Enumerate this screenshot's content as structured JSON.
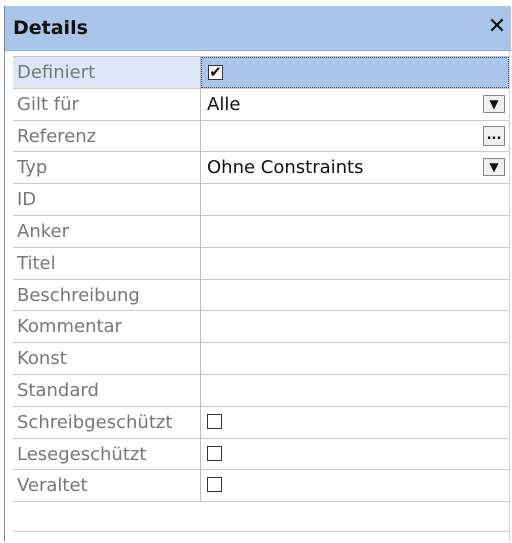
{
  "panel": {
    "title": "Details",
    "close_glyph": "✕"
  },
  "rows": [
    {
      "label": "Definiert",
      "type": "checkbox",
      "checked": true
    },
    {
      "label": "Gilt für",
      "type": "dropdown",
      "value": "Alle"
    },
    {
      "label": "Referenz",
      "type": "ellipsis",
      "value": ""
    },
    {
      "label": "Typ",
      "type": "dropdown",
      "value": "Ohne Constraints"
    },
    {
      "label": "ID",
      "type": "text",
      "value": ""
    },
    {
      "label": "Anker",
      "type": "text",
      "value": ""
    },
    {
      "label": "Titel",
      "type": "text",
      "value": ""
    },
    {
      "label": "Beschreibung",
      "type": "text",
      "value": ""
    },
    {
      "label": "Kommentar",
      "type": "text",
      "value": ""
    },
    {
      "label": "Konst",
      "type": "text",
      "value": ""
    },
    {
      "label": "Standard",
      "type": "text",
      "value": ""
    },
    {
      "label": "Schreibgeschützt",
      "type": "checkbox",
      "checked": false
    },
    {
      "label": "Lesegeschützt",
      "type": "checkbox",
      "checked": false
    },
    {
      "label": "Veraltet",
      "type": "checkbox",
      "checked": false
    }
  ],
  "icons": {
    "dropdown": "▼",
    "ellipsis": "...",
    "check": "✔"
  },
  "colors": {
    "titlebar": "#a9c5ea",
    "selected_value": "#a9c5ea"
  }
}
